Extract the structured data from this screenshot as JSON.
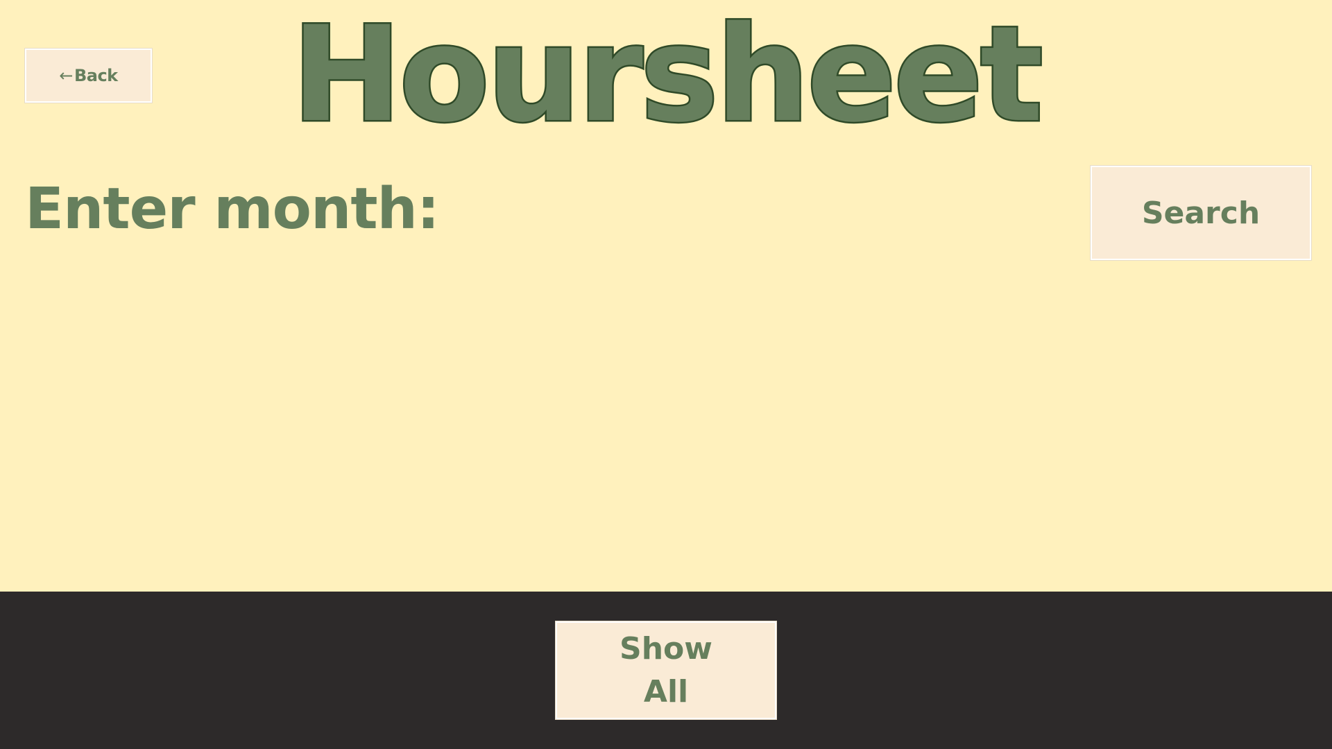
{
  "header": {
    "title": "Hoursheet",
    "back_arrow": "←",
    "back_label": "Back"
  },
  "search": {
    "label": "Enter month:",
    "value": "",
    "button_label": "Search"
  },
  "footer": {
    "show_all_label": "Show All"
  },
  "colors": {
    "background": "#fff1bd",
    "footer_background": "#2d2a2a",
    "accent_green": "#667f5d",
    "title_outline": "#2f4a28",
    "button_background": "#faebd6"
  },
  "icons": {
    "back": "left-arrow-icon"
  }
}
